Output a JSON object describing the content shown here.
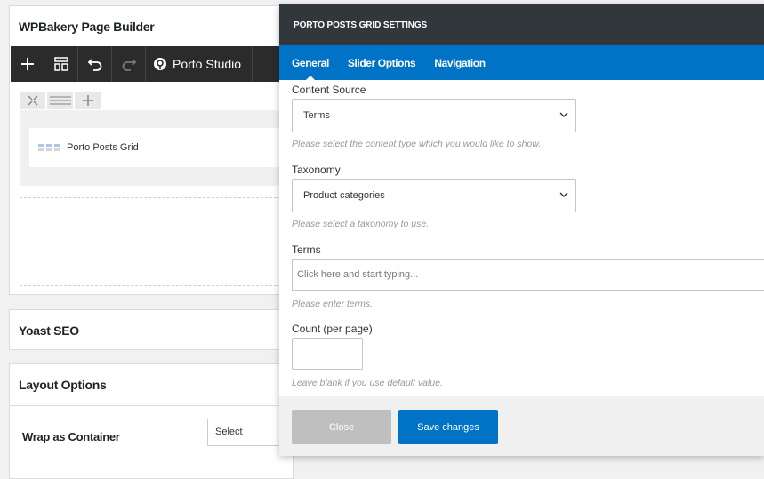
{
  "wpbakery": {
    "title": "WPBakery Page Builder",
    "studio_label": "Porto Studio",
    "element_label": "Porto Posts Grid"
  },
  "yoast": {
    "title": "Yoast SEO"
  },
  "layout_options": {
    "title": "Layout Options",
    "wrap_label": "Wrap as Container",
    "wrap_select_value": "Select"
  },
  "modal": {
    "title": "PORTO POSTS GRID SETTINGS",
    "tabs": [
      {
        "label": "General",
        "active": true
      },
      {
        "label": "Slider Options",
        "active": false
      },
      {
        "label": "Navigation",
        "active": false
      }
    ],
    "fields": {
      "content_source": {
        "label": "Content Source",
        "value": "Terms",
        "help": "Please select the content type which you would like to show."
      },
      "taxonomy": {
        "label": "Taxonomy",
        "value": "Product categories",
        "help": "Please select a taxonomy to use."
      },
      "terms": {
        "label": "Terms",
        "placeholder": "Click here and start typing...",
        "help": "Please enter terms."
      },
      "count": {
        "label": "Count (per page)",
        "value": "",
        "help": "Leave blank if you use default value."
      }
    },
    "buttons": {
      "close": "Close",
      "save": "Save changes"
    }
  },
  "colors": {
    "modal_header": "#32373c",
    "tab_bar": "#0073c6",
    "save_button": "#0073c6",
    "close_button": "#bfbfbf",
    "toolbar": "#2b2b2b"
  }
}
